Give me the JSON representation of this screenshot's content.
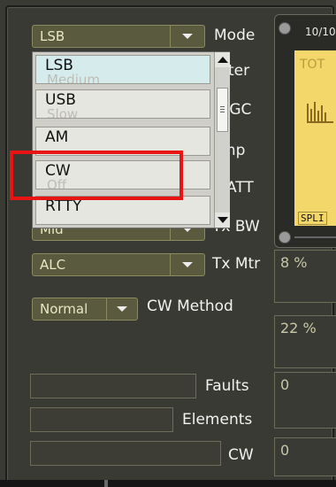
{
  "mode": {
    "value": "LSB",
    "label": "Mode"
  },
  "filter": {
    "value": "Medium",
    "label": "Filter"
  },
  "agc": {
    "value": "Slow",
    "label": "AGC"
  },
  "pre_amp": {
    "value": "Off",
    "label": "Pre Amp"
  },
  "att": {
    "value": "Off",
    "label": "ATT"
  },
  "tx_bw": {
    "value": "Mid",
    "label": "Tx BW"
  },
  "tx_mtr": {
    "value": "ALC",
    "label": "Tx Mtr"
  },
  "cw_method": {
    "value": "Normal",
    "label": "CW Method"
  },
  "status": {
    "faults_label": "Faults",
    "elements_label": "Elements",
    "cw_label": "CW"
  },
  "right_panel": {
    "tx_mtr_value": "8 %",
    "cw_method_value": "22 %",
    "faults_value": "0",
    "cw_value": "0",
    "date": "10/10",
    "tot_label": "TOT",
    "split_label": "SPLI"
  },
  "mode_dropdown": {
    "options": [
      "LSB",
      "USB",
      "AM",
      "CW",
      "RTTY"
    ],
    "highlighted": "CW"
  }
}
